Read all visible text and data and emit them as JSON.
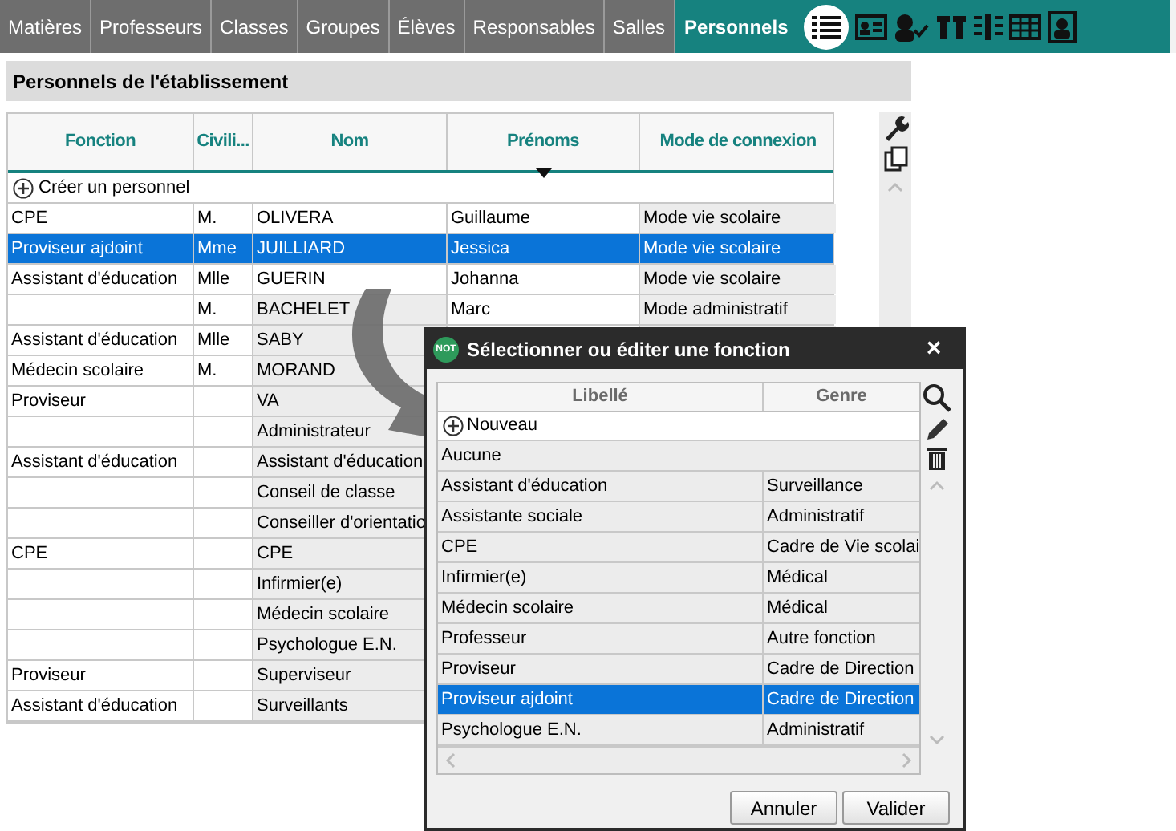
{
  "tabs": [
    {
      "label": "Matières",
      "selected": false
    },
    {
      "label": "Professeurs",
      "selected": false
    },
    {
      "label": "Classes",
      "selected": false
    },
    {
      "label": "Groupes",
      "selected": false
    },
    {
      "label": "Élèves",
      "selected": false
    },
    {
      "label": "Responsables",
      "selected": false
    },
    {
      "label": "Salles",
      "selected": false
    },
    {
      "label": "Personnels",
      "selected": true
    }
  ],
  "panel": {
    "title": "Personnels de l'établissement",
    "table": {
      "columns": [
        "Fonction",
        "Civili...",
        "Nom",
        "Prénoms",
        "Mode de connexion"
      ],
      "create_label": "Créer un personnel",
      "rows": [
        {
          "cells": [
            "CPE",
            "M.",
            "OLIVERA",
            "Guillaume",
            "Mode vie scolaire"
          ],
          "selected": false
        },
        {
          "cells": [
            "Proviseur ajdoint",
            "Mme",
            "JUILLIARD",
            "Jessica",
            "Mode vie scolaire"
          ],
          "selected": true
        },
        {
          "cells": [
            "Assistant d'éducation",
            "Mlle",
            "GUERIN",
            "Johanna",
            "Mode vie scolaire"
          ],
          "selected": false
        },
        {
          "cells": [
            "",
            "M.",
            "BACHELET",
            "Marc",
            "Mode administratif"
          ],
          "selected": false
        },
        {
          "cells": [
            "Assistant d'éducation",
            "Mlle",
            "SABY"
          ],
          "selected": false
        },
        {
          "cells": [
            "Médecin scolaire",
            "M.",
            "MORAND"
          ],
          "selected": false
        },
        {
          "cells": [
            "Proviseur",
            "",
            "VA"
          ],
          "selected": false
        },
        {
          "cells": [
            "",
            "",
            "Administrateur"
          ],
          "selected": false
        },
        {
          "cells": [
            "Assistant d'éducation",
            "",
            "Assistant d'éducation"
          ],
          "selected": false
        },
        {
          "cells": [
            "",
            "",
            "Conseil de classe"
          ],
          "selected": false
        },
        {
          "cells": [
            "",
            "",
            "Conseiller d'orientatio"
          ],
          "selected": false
        },
        {
          "cells": [
            "CPE",
            "",
            "CPE"
          ],
          "selected": false
        },
        {
          "cells": [
            "",
            "",
            "Infirmier(e)"
          ],
          "selected": false
        },
        {
          "cells": [
            "",
            "",
            "Médecin scolaire"
          ],
          "selected": false
        },
        {
          "cells": [
            "",
            "",
            "Psychologue E.N."
          ],
          "selected": false
        },
        {
          "cells": [
            "Proviseur",
            "",
            "Superviseur"
          ],
          "selected": false
        },
        {
          "cells": [
            "Assistant d'éducation",
            "",
            "Surveillants"
          ],
          "selected": false
        }
      ]
    }
  },
  "dialog": {
    "title": "Sélectionner ou éditer une fonction",
    "badge": "NOT",
    "close": "×",
    "columns": [
      "Libellé",
      "Genre"
    ],
    "new_label": "Nouveau",
    "rows": [
      {
        "cells": [
          "Aucune"
        ],
        "selected": false
      },
      {
        "cells": [
          "Assistant d'éducation",
          "Surveillance"
        ],
        "selected": false
      },
      {
        "cells": [
          "Assistante sociale",
          "Administratif"
        ],
        "selected": false
      },
      {
        "cells": [
          "CPE",
          "Cadre de Vie scolai"
        ],
        "selected": false
      },
      {
        "cells": [
          "Infirmier(e)",
          "Médical"
        ],
        "selected": false
      },
      {
        "cells": [
          "Médecin scolaire",
          "Médical"
        ],
        "selected": false
      },
      {
        "cells": [
          "Professeur",
          "Autre fonction"
        ],
        "selected": false
      },
      {
        "cells": [
          "Proviseur",
          "Cadre de Direction"
        ],
        "selected": false
      },
      {
        "cells": [
          "Proviseur ajdoint",
          "Cadre de Direction"
        ],
        "selected": true
      },
      {
        "cells": [
          "Psychologue E.N.",
          "Administratif"
        ],
        "selected": false
      }
    ],
    "buttons": [
      "Annuler",
      "Valider"
    ]
  }
}
